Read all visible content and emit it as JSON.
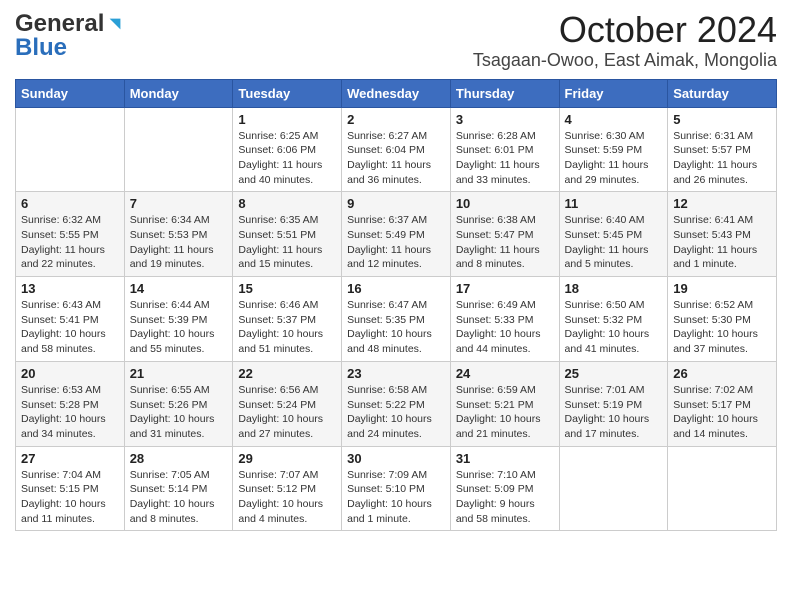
{
  "header": {
    "logo_general": "General",
    "logo_blue": "Blue",
    "month_title": "October 2024",
    "location": "Tsagaan-Owoo, East Aimak, Mongolia"
  },
  "days_of_week": [
    "Sunday",
    "Monday",
    "Tuesday",
    "Wednesday",
    "Thursday",
    "Friday",
    "Saturday"
  ],
  "weeks": [
    [
      {
        "day": "",
        "sunrise": "",
        "sunset": "",
        "daylight": ""
      },
      {
        "day": "",
        "sunrise": "",
        "sunset": "",
        "daylight": ""
      },
      {
        "day": "1",
        "sunrise": "Sunrise: 6:25 AM",
        "sunset": "Sunset: 6:06 PM",
        "daylight": "Daylight: 11 hours and 40 minutes."
      },
      {
        "day": "2",
        "sunrise": "Sunrise: 6:27 AM",
        "sunset": "Sunset: 6:04 PM",
        "daylight": "Daylight: 11 hours and 36 minutes."
      },
      {
        "day": "3",
        "sunrise": "Sunrise: 6:28 AM",
        "sunset": "Sunset: 6:01 PM",
        "daylight": "Daylight: 11 hours and 33 minutes."
      },
      {
        "day": "4",
        "sunrise": "Sunrise: 6:30 AM",
        "sunset": "Sunset: 5:59 PM",
        "daylight": "Daylight: 11 hours and 29 minutes."
      },
      {
        "day": "5",
        "sunrise": "Sunrise: 6:31 AM",
        "sunset": "Sunset: 5:57 PM",
        "daylight": "Daylight: 11 hours and 26 minutes."
      }
    ],
    [
      {
        "day": "6",
        "sunrise": "Sunrise: 6:32 AM",
        "sunset": "Sunset: 5:55 PM",
        "daylight": "Daylight: 11 hours and 22 minutes."
      },
      {
        "day": "7",
        "sunrise": "Sunrise: 6:34 AM",
        "sunset": "Sunset: 5:53 PM",
        "daylight": "Daylight: 11 hours and 19 minutes."
      },
      {
        "day": "8",
        "sunrise": "Sunrise: 6:35 AM",
        "sunset": "Sunset: 5:51 PM",
        "daylight": "Daylight: 11 hours and 15 minutes."
      },
      {
        "day": "9",
        "sunrise": "Sunrise: 6:37 AM",
        "sunset": "Sunset: 5:49 PM",
        "daylight": "Daylight: 11 hours and 12 minutes."
      },
      {
        "day": "10",
        "sunrise": "Sunrise: 6:38 AM",
        "sunset": "Sunset: 5:47 PM",
        "daylight": "Daylight: 11 hours and 8 minutes."
      },
      {
        "day": "11",
        "sunrise": "Sunrise: 6:40 AM",
        "sunset": "Sunset: 5:45 PM",
        "daylight": "Daylight: 11 hours and 5 minutes."
      },
      {
        "day": "12",
        "sunrise": "Sunrise: 6:41 AM",
        "sunset": "Sunset: 5:43 PM",
        "daylight": "Daylight: 11 hours and 1 minute."
      }
    ],
    [
      {
        "day": "13",
        "sunrise": "Sunrise: 6:43 AM",
        "sunset": "Sunset: 5:41 PM",
        "daylight": "Daylight: 10 hours and 58 minutes."
      },
      {
        "day": "14",
        "sunrise": "Sunrise: 6:44 AM",
        "sunset": "Sunset: 5:39 PM",
        "daylight": "Daylight: 10 hours and 55 minutes."
      },
      {
        "day": "15",
        "sunrise": "Sunrise: 6:46 AM",
        "sunset": "Sunset: 5:37 PM",
        "daylight": "Daylight: 10 hours and 51 minutes."
      },
      {
        "day": "16",
        "sunrise": "Sunrise: 6:47 AM",
        "sunset": "Sunset: 5:35 PM",
        "daylight": "Daylight: 10 hours and 48 minutes."
      },
      {
        "day": "17",
        "sunrise": "Sunrise: 6:49 AM",
        "sunset": "Sunset: 5:33 PM",
        "daylight": "Daylight: 10 hours and 44 minutes."
      },
      {
        "day": "18",
        "sunrise": "Sunrise: 6:50 AM",
        "sunset": "Sunset: 5:32 PM",
        "daylight": "Daylight: 10 hours and 41 minutes."
      },
      {
        "day": "19",
        "sunrise": "Sunrise: 6:52 AM",
        "sunset": "Sunset: 5:30 PM",
        "daylight": "Daylight: 10 hours and 37 minutes."
      }
    ],
    [
      {
        "day": "20",
        "sunrise": "Sunrise: 6:53 AM",
        "sunset": "Sunset: 5:28 PM",
        "daylight": "Daylight: 10 hours and 34 minutes."
      },
      {
        "day": "21",
        "sunrise": "Sunrise: 6:55 AM",
        "sunset": "Sunset: 5:26 PM",
        "daylight": "Daylight: 10 hours and 31 minutes."
      },
      {
        "day": "22",
        "sunrise": "Sunrise: 6:56 AM",
        "sunset": "Sunset: 5:24 PM",
        "daylight": "Daylight: 10 hours and 27 minutes."
      },
      {
        "day": "23",
        "sunrise": "Sunrise: 6:58 AM",
        "sunset": "Sunset: 5:22 PM",
        "daylight": "Daylight: 10 hours and 24 minutes."
      },
      {
        "day": "24",
        "sunrise": "Sunrise: 6:59 AM",
        "sunset": "Sunset: 5:21 PM",
        "daylight": "Daylight: 10 hours and 21 minutes."
      },
      {
        "day": "25",
        "sunrise": "Sunrise: 7:01 AM",
        "sunset": "Sunset: 5:19 PM",
        "daylight": "Daylight: 10 hours and 17 minutes."
      },
      {
        "day": "26",
        "sunrise": "Sunrise: 7:02 AM",
        "sunset": "Sunset: 5:17 PM",
        "daylight": "Daylight: 10 hours and 14 minutes."
      }
    ],
    [
      {
        "day": "27",
        "sunrise": "Sunrise: 7:04 AM",
        "sunset": "Sunset: 5:15 PM",
        "daylight": "Daylight: 10 hours and 11 minutes."
      },
      {
        "day": "28",
        "sunrise": "Sunrise: 7:05 AM",
        "sunset": "Sunset: 5:14 PM",
        "daylight": "Daylight: 10 hours and 8 minutes."
      },
      {
        "day": "29",
        "sunrise": "Sunrise: 7:07 AM",
        "sunset": "Sunset: 5:12 PM",
        "daylight": "Daylight: 10 hours and 4 minutes."
      },
      {
        "day": "30",
        "sunrise": "Sunrise: 7:09 AM",
        "sunset": "Sunset: 5:10 PM",
        "daylight": "Daylight: 10 hours and 1 minute."
      },
      {
        "day": "31",
        "sunrise": "Sunrise: 7:10 AM",
        "sunset": "Sunset: 5:09 PM",
        "daylight": "Daylight: 9 hours and 58 minutes."
      },
      {
        "day": "",
        "sunrise": "",
        "sunset": "",
        "daylight": ""
      },
      {
        "day": "",
        "sunrise": "",
        "sunset": "",
        "daylight": ""
      }
    ]
  ]
}
